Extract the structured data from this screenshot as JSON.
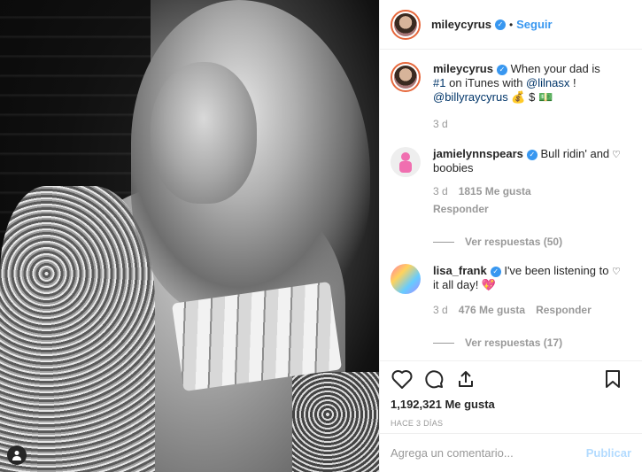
{
  "header": {
    "username": "mileycyrus",
    "verified_icon": "verified-badge-icon",
    "separator": "•",
    "follow_label": "Seguir"
  },
  "caption": {
    "username": "mileycyrus",
    "text_1": "When your dad is ",
    "hashtag": "#1",
    "text_2": "on iTunes with ",
    "mention_1": "@lilnasx",
    "text_3": " !",
    "mention_2": "@billyraycyrus",
    "emojis": "💰 $ 💵",
    "time": "3 d"
  },
  "comments": [
    {
      "username": "jamielynnspears",
      "text": "Bull ridin' and boobies",
      "time": "3 d",
      "likes": "1815 Me gusta",
      "reply_label": "Responder",
      "view_replies": "Ver respuestas (50)"
    },
    {
      "username": "lisa_frank",
      "text": "I've been listening to it all day! 💖",
      "time": "3 d",
      "likes": "476 Me gusta",
      "reply_label": "Responder",
      "view_replies": "Ver respuestas (17)"
    }
  ],
  "likes_count": "1,192,321 Me gusta",
  "post_time": "HACE 3 DÍAS",
  "add_comment": {
    "placeholder": "Agrega un comentario...",
    "publish_label": "Publicar"
  },
  "colors": {
    "accent": "#3897f0",
    "muted": "#999999",
    "link": "#003569",
    "publish_disabled": "#b3dbff"
  }
}
